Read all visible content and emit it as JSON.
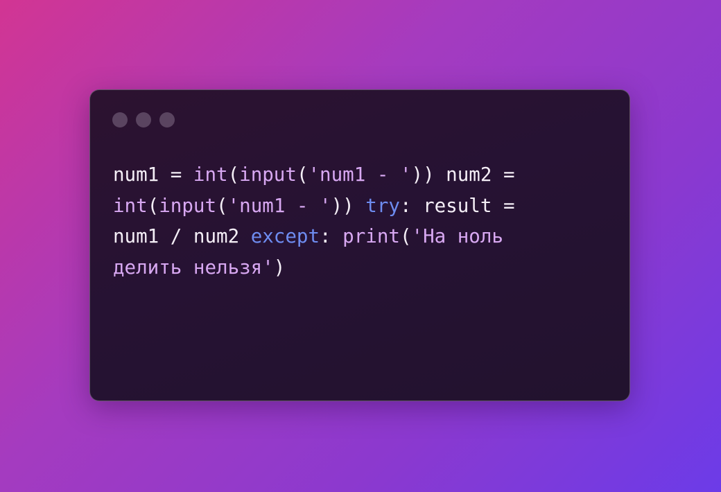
{
  "window_controls": [
    "dot-icon",
    "dot-icon",
    "dot-icon"
  ],
  "colors": {
    "plain": "#f4eef6",
    "function": "#d8a8f2",
    "string": "#d8a8f2",
    "keyword": "#6e8cf0",
    "dot": "#5a4460"
  },
  "code": {
    "line1": {
      "t1": "num1 = ",
      "t2": "int",
      "t3": "(",
      "t4": "input",
      "t5": "(",
      "t6": "'num1 - '",
      "t7": ")) num2 ="
    },
    "line2": {
      "t1": "int",
      "t2": "(",
      "t3": "input",
      "t4": "(",
      "t5": "'num1 - '",
      "t6": ")) ",
      "t7": "try",
      "t8": ": result ="
    },
    "line3": {
      "t1": "num1 / num2 ",
      "t2": "except",
      "t3": ": ",
      "t4": "print",
      "t5": "(",
      "t6": "'На ноль"
    },
    "line4": {
      "t1": "делить нельзя'",
      "t2": ")"
    }
  }
}
